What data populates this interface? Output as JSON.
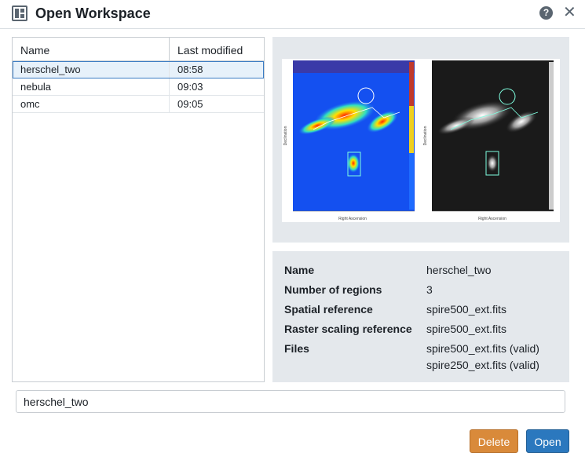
{
  "dialog": {
    "title": "Open Workspace",
    "help_icon": "question-circle-icon",
    "close_icon": "close-icon",
    "app_icon": "layout-panels-icon"
  },
  "list": {
    "headers": [
      "Name",
      "Last modified"
    ],
    "rows": [
      {
        "name": "herschel_two",
        "modified": "08:58",
        "selected": true
      },
      {
        "name": "nebula",
        "modified": "09:03",
        "selected": false
      },
      {
        "name": "omc",
        "modified": "09:05",
        "selected": false
      }
    ]
  },
  "details": {
    "name_label": "Name",
    "name_value": "herschel_two",
    "regions_label": "Number of regions",
    "regions_value": "3",
    "spatial_label": "Spatial reference",
    "spatial_value": "spire500_ext.fits",
    "raster_label": "Raster scaling reference",
    "raster_value": "spire500_ext.fits",
    "files_label": "Files",
    "files": [
      "spire500_ext.fits (valid)",
      "spire250_ext.fits (valid)"
    ]
  },
  "preview": {
    "left_xlabel": "Right Ascension",
    "right_xlabel": "Right Ascension",
    "left_ylabel": "Declination",
    "right_ylabel": "Declination"
  },
  "input": {
    "value": "herschel_two"
  },
  "buttons": {
    "delete": "Delete",
    "open": "Open"
  },
  "colors": {
    "delete_bg": "#d98a3a",
    "open_bg": "#2b78be",
    "selection": "#e7f1fa"
  }
}
